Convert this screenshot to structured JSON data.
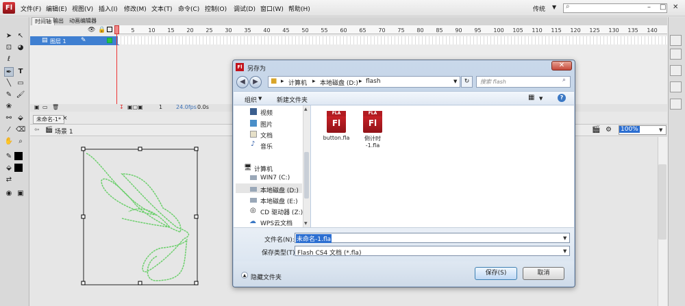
{
  "app": {
    "logo": "Fl",
    "menu": [
      "文件(F)",
      "编辑(E)",
      "视图(V)",
      "插入(I)",
      "修改(M)",
      "文本(T)",
      "命令(C)",
      "控制(O)",
      "调试(D)",
      "窗口(W)",
      "帮助(H)"
    ],
    "workspace": "传统",
    "window_controls": {
      "minimize": "–",
      "maximize": "□",
      "close": "✕"
    }
  },
  "timeline": {
    "tabs": [
      "时间轴",
      "输出",
      "动画编辑器"
    ],
    "layer_name": "图层 1",
    "frame_ticks": [
      "1",
      "5",
      "10",
      "15",
      "20",
      "25",
      "30",
      "35",
      "40",
      "45",
      "50",
      "55",
      "60",
      "65",
      "70",
      "75",
      "80",
      "85",
      "90",
      "95",
      "100",
      "105",
      "110",
      "115",
      "120",
      "125",
      "130",
      "135",
      "140"
    ],
    "status": {
      "frame": "1",
      "fps": "24.0fps",
      "time": "0.0s"
    }
  },
  "document": {
    "tab": "未命名-1*",
    "scene": "场景 1",
    "zoom": "100%"
  },
  "dialog": {
    "title": "另存为",
    "path": [
      "计算机",
      "本地磁盘 (D:)",
      "flash"
    ],
    "search_placeholder": "搜索 flash",
    "organize": "组织",
    "new_folder": "新建文件夹",
    "help": "?",
    "nav_items": [
      {
        "label": "视频",
        "icon": "video-library-icon"
      },
      {
        "label": "图片",
        "icon": "pictures-library-icon"
      },
      {
        "label": "文档",
        "icon": "documents-library-icon"
      },
      {
        "label": "音乐",
        "icon": "music-library-icon"
      },
      {
        "label": "计算机",
        "icon": "computer-icon"
      },
      {
        "label": "WIN7 (C:)",
        "icon": "drive-icon"
      },
      {
        "label": "本地磁盘 (D:)",
        "icon": "drive-icon"
      },
      {
        "label": "本地磁盘 (E:)",
        "icon": "drive-icon"
      },
      {
        "label": "CD 驱动器 (Z:)",
        "icon": "cd-drive-icon"
      },
      {
        "label": "WPS云文档",
        "icon": "cloud-icon"
      }
    ],
    "files": [
      {
        "name": "button.fla",
        "icon_cap": "FLA",
        "icon_text": "Fl"
      },
      {
        "name_line1": "倒计时",
        "name_line2": "-1.fla",
        "icon_cap": "FLA",
        "icon_text": "Fl"
      }
    ],
    "filename_label": "文件名(N):",
    "filename_value": "未命名-1.fla",
    "filetype_label": "保存类型(T):",
    "filetype_value": "Flash CS4 文档 (*.fla)",
    "hide_folders": "隐藏文件夹",
    "save": "保存(S)",
    "cancel": "取消"
  }
}
